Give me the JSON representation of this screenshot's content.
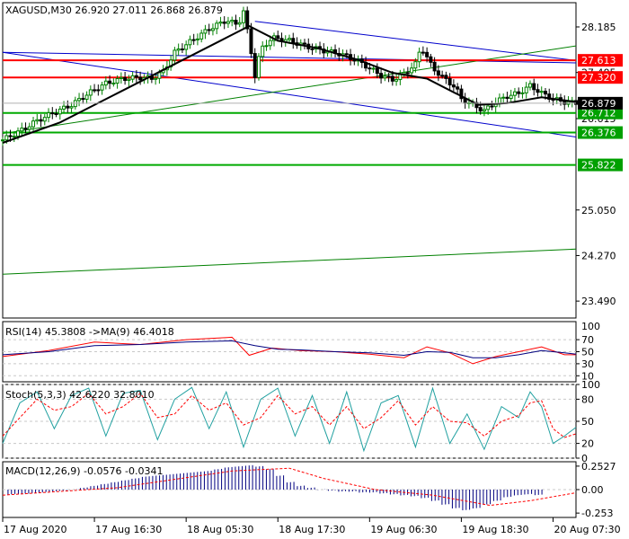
{
  "chart_data": [
    {
      "type": "candlestick",
      "title": "XAGUSD,M30",
      "ohlc_readout": [
        "26.920",
        "27.011",
        "26.868",
        "26.879"
      ],
      "ylim": [
        23.2,
        28.6
      ],
      "y_ticks": [
        "28.185",
        "27.405",
        "26.615",
        "25.050",
        "24.270",
        "23.490"
      ],
      "y_tick_values": [
        28.185,
        27.405,
        26.615,
        25.05,
        24.27,
        23.49
      ],
      "current_price": {
        "label": "26.879",
        "value": 26.879
      },
      "support_lines": [
        {
          "label": "26.712",
          "value": 26.712
        },
        {
          "label": "26.376",
          "value": 26.376
        },
        {
          "label": "25.822",
          "value": 25.822
        }
      ],
      "resistance_lines": [
        {
          "label": "27.613",
          "value": 27.613
        },
        {
          "label": "27.320",
          "value": 27.32
        }
      ],
      "trend_lines": [
        {
          "color": "#0000cc",
          "from": [
            0,
            27.75
          ],
          "to": [
            100,
            27.57
          ]
        },
        {
          "color": "#0000cc",
          "from": [
            0,
            27.75
          ],
          "to": [
            100,
            26.3
          ]
        },
        {
          "color": "#0000cc",
          "from": [
            44,
            28.28
          ],
          "to": [
            100,
            27.61
          ]
        },
        {
          "color": "#008000",
          "from": [
            0,
            26.36
          ],
          "to": [
            100,
            27.86
          ]
        },
        {
          "color": "#008000",
          "from": [
            0,
            23.95
          ],
          "to": [
            100,
            24.38
          ]
        }
      ],
      "close_path": [
        [
          0,
          26.25
        ],
        [
          3,
          26.4
        ],
        [
          6,
          26.58
        ],
        [
          9,
          26.72
        ],
        [
          12,
          26.85
        ],
        [
          15,
          27.05
        ],
        [
          18,
          27.22
        ],
        [
          21,
          27.3
        ],
        [
          24,
          27.32
        ],
        [
          26,
          27.3
        ],
        [
          28,
          27.42
        ],
        [
          30,
          27.75
        ],
        [
          33,
          27.95
        ],
        [
          36,
          28.15
        ],
        [
          39,
          28.3
        ],
        [
          41,
          28.22
        ],
        [
          42,
          28.45
        ],
        [
          43,
          27.95
        ],
        [
          44,
          27.35
        ],
        [
          45,
          27.8
        ],
        [
          47,
          28.0
        ],
        [
          50,
          27.95
        ],
        [
          53,
          27.85
        ],
        [
          56,
          27.78
        ],
        [
          59,
          27.72
        ],
        [
          62,
          27.6
        ],
        [
          64,
          27.48
        ],
        [
          66,
          27.35
        ],
        [
          68,
          27.28
        ],
        [
          70,
          27.38
        ],
        [
          72,
          27.55
        ],
        [
          73,
          27.85
        ],
        [
          75,
          27.48
        ],
        [
          77,
          27.3
        ],
        [
          79,
          27.15
        ],
        [
          80,
          26.95
        ],
        [
          82,
          26.85
        ],
        [
          84,
          26.75
        ],
        [
          86,
          26.9
        ],
        [
          88,
          27.0
        ],
        [
          90,
          27.05
        ],
        [
          92,
          27.18
        ],
        [
          94,
          27.05
        ],
        [
          96,
          26.95
        ],
        [
          98,
          26.9
        ],
        [
          100,
          26.88
        ]
      ],
      "ma_path": [
        [
          0,
          26.2
        ],
        [
          10,
          26.55
        ],
        [
          20,
          27.05
        ],
        [
          30,
          27.55
        ],
        [
          38,
          27.95
        ],
        [
          43,
          28.2
        ],
        [
          48,
          27.95
        ],
        [
          55,
          27.82
        ],
        [
          62,
          27.62
        ],
        [
          68,
          27.4
        ],
        [
          74,
          27.3
        ],
        [
          79,
          27.05
        ],
        [
          83,
          26.85
        ],
        [
          88,
          26.88
        ],
        [
          94,
          26.98
        ],
        [
          100,
          26.9
        ]
      ],
      "x_ticks": [
        "17 Aug 2020",
        "17 Aug 16:30",
        "18 Aug 05:30",
        "18 Aug 17:30",
        "19 Aug 06:30",
        "19 Aug 18:30",
        "20 Aug 07:30"
      ],
      "x_tick_pos": [
        0,
        16,
        32,
        48,
        64,
        80,
        96
      ]
    },
    {
      "type": "line",
      "title": "RSI(14) 45.3808 ->MA(9) 46.4018",
      "ylim": [
        0,
        100
      ],
      "y_ticks": [
        "70",
        "50",
        "30",
        "10"
      ],
      "y_tick_values": [
        70,
        50,
        30,
        10
      ],
      "extra_y_ticks": [
        "100"
      ],
      "series": [
        {
          "color": "#ff0000",
          "values": [
            [
              0,
              42
            ],
            [
              8,
              52
            ],
            [
              16,
              66
            ],
            [
              24,
              62
            ],
            [
              32,
              70
            ],
            [
              40,
              74
            ],
            [
              43,
              44
            ],
            [
              47,
              56
            ],
            [
              52,
              52
            ],
            [
              58,
              50
            ],
            [
              64,
              46
            ],
            [
              70,
              40
            ],
            [
              74,
              58
            ],
            [
              78,
              48
            ],
            [
              82,
              30
            ],
            [
              86,
              42
            ],
            [
              90,
              50
            ],
            [
              94,
              58
            ],
            [
              98,
              45
            ],
            [
              100,
              45
            ]
          ]
        },
        {
          "color": "#000080",
          "values": [
            [
              0,
              45
            ],
            [
              8,
              50
            ],
            [
              16,
              60
            ],
            [
              24,
              62
            ],
            [
              32,
              66
            ],
            [
              40,
              68
            ],
            [
              44,
              60
            ],
            [
              48,
              54
            ],
            [
              52,
              53
            ],
            [
              58,
              50
            ],
            [
              64,
              48
            ],
            [
              70,
              44
            ],
            [
              74,
              50
            ],
            [
              78,
              49
            ],
            [
              82,
              40
            ],
            [
              86,
              40
            ],
            [
              90,
              45
            ],
            [
              94,
              52
            ],
            [
              98,
              48
            ],
            [
              100,
              46
            ]
          ]
        }
      ]
    },
    {
      "type": "line",
      "title": "Stoch(5,3,3) 42.6220 32.8010",
      "ylim": [
        0,
        100
      ],
      "y_ticks": [
        "100",
        "80",
        "50",
        "20",
        "0"
      ],
      "y_tick_values": [
        100,
        80,
        50,
        20,
        0
      ],
      "series": [
        {
          "color": "#20a0a0",
          "values": [
            [
              0,
              20
            ],
            [
              3,
              75
            ],
            [
              6,
              90
            ],
            [
              9,
              40
            ],
            [
              12,
              85
            ],
            [
              15,
              95
            ],
            [
              18,
              30
            ],
            [
              21,
              88
            ],
            [
              24,
              92
            ],
            [
              27,
              25
            ],
            [
              30,
              80
            ],
            [
              33,
              96
            ],
            [
              36,
              40
            ],
            [
              39,
              90
            ],
            [
              42,
              15
            ],
            [
              45,
              80
            ],
            [
              48,
              95
            ],
            [
              51,
              30
            ],
            [
              54,
              85
            ],
            [
              57,
              20
            ],
            [
              60,
              90
            ],
            [
              63,
              10
            ],
            [
              66,
              75
            ],
            [
              69,
              85
            ],
            [
              72,
              15
            ],
            [
              75,
              95
            ],
            [
              78,
              20
            ],
            [
              81,
              60
            ],
            [
              84,
              12
            ],
            [
              87,
              70
            ],
            [
              90,
              55
            ],
            [
              92,
              90
            ],
            [
              94,
              70
            ],
            [
              96,
              20
            ],
            [
              98,
              30
            ],
            [
              100,
              42
            ]
          ]
        },
        {
          "color": "#ff0000",
          "values": [
            [
              0,
              30
            ],
            [
              3,
              55
            ],
            [
              6,
              80
            ],
            [
              9,
              65
            ],
            [
              12,
              70
            ],
            [
              15,
              88
            ],
            [
              18,
              60
            ],
            [
              21,
              70
            ],
            [
              24,
              88
            ],
            [
              27,
              55
            ],
            [
              30,
              60
            ],
            [
              33,
              85
            ],
            [
              36,
              65
            ],
            [
              39,
              75
            ],
            [
              42,
              45
            ],
            [
              45,
              55
            ],
            [
              48,
              85
            ],
            [
              51,
              60
            ],
            [
              54,
              70
            ],
            [
              57,
              45
            ],
            [
              60,
              70
            ],
            [
              63,
              40
            ],
            [
              66,
              55
            ],
            [
              69,
              78
            ],
            [
              72,
              45
            ],
            [
              75,
              70
            ],
            [
              78,
              50
            ],
            [
              81,
              48
            ],
            [
              84,
              30
            ],
            [
              87,
              50
            ],
            [
              90,
              58
            ],
            [
              92,
              75
            ],
            [
              94,
              78
            ],
            [
              96,
              40
            ],
            [
              98,
              28
            ],
            [
              100,
              33
            ]
          ]
        }
      ]
    },
    {
      "type": "bar",
      "title": "MACD(12,26,9) -0.0576 -0.0341",
      "ylim": [
        -0.3,
        0.3
      ],
      "y_ticks": [
        "0.2527",
        "0.00",
        "-0.253"
      ],
      "y_tick_values": [
        0.2527,
        0.0,
        -0.253
      ],
      "histogram": [
        -0.05,
        -0.045,
        -0.04,
        -0.03,
        -0.02,
        -0.01,
        0.0,
        0.02,
        0.04,
        0.06,
        0.08,
        0.1,
        0.12,
        0.14,
        0.15,
        0.16,
        0.17,
        0.18,
        0.19,
        0.2,
        0.22,
        0.24,
        0.25,
        0.26,
        0.25,
        0.22,
        0.15,
        0.08,
        0.04,
        0.02,
        0.0,
        -0.01,
        -0.02,
        -0.02,
        -0.03,
        -0.03,
        -0.04,
        -0.05,
        -0.06,
        -0.07,
        -0.09,
        -0.12,
        -0.16,
        -0.2,
        -0.22,
        -0.2,
        -0.16,
        -0.12,
        -0.08,
        -0.06,
        -0.05,
        -0.057
      ],
      "signal": [
        [
          0,
          -0.06
        ],
        [
          20,
          0.02
        ],
        [
          40,
          0.2
        ],
        [
          50,
          0.23
        ],
        [
          56,
          0.12
        ],
        [
          65,
          0.0
        ],
        [
          75,
          -0.06
        ],
        [
          85,
          -0.17
        ],
        [
          92,
          -0.12
        ],
        [
          100,
          -0.034
        ]
      ],
      "series": [
        {
          "color": "#000080",
          "values": []
        },
        {
          "color": "#ff0000",
          "values": []
        }
      ]
    }
  ],
  "colors": {
    "grid": "#c8c8c8",
    "support": "#00aa00",
    "resistance": "#ff0000",
    "candle_up": "#008000",
    "candle_down": "#000000",
    "tag_green": "#00a000",
    "tag_red": "#ff0000",
    "tag_dark": "#000000"
  }
}
